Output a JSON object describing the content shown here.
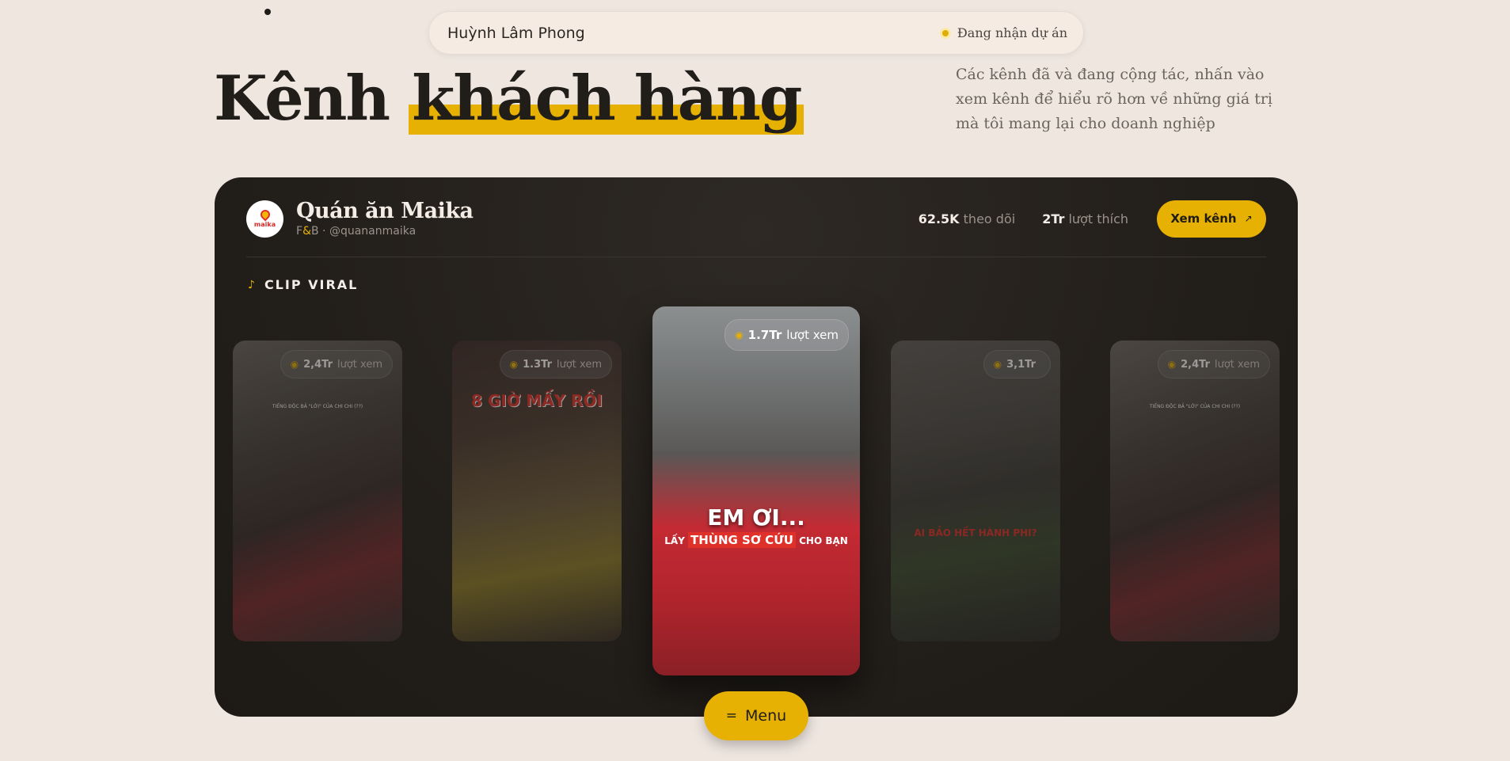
{
  "top_bar": {
    "name": "Huỳnh Lâm Phong",
    "status": "Đang nhận dự án"
  },
  "hero": {
    "title_plain": "Kênh",
    "title_highlight": "khách hàng",
    "description": "Các kênh đã và đang cộng tác, nhấn vào xem kênh để hiểu rõ hơn về những giá trị mà tôi mang lại cho doanh nghiệp"
  },
  "channel": {
    "logo_text": "maika",
    "name": "Quán ăn Maika",
    "category_pre": "F",
    "category_amp": "&",
    "category_post": "B",
    "handle": "· @quananmaika",
    "followers_value": "62.5K",
    "followers_label": "theo dõi",
    "likes_value": "2Tr",
    "likes_label": "lượt thích",
    "view_button": "Xem kênh",
    "view_button_icon": "arrow-up-right-icon"
  },
  "clips_section": {
    "label": "CLIP VIRAL",
    "icon": "music-note-icon"
  },
  "clips": [
    {
      "views": "2,4Tr",
      "views_label": "lượt xem",
      "caption": "TIẾNG ĐỘC BẢ \"LỚI\" CỦA CHI CHI (??)"
    },
    {
      "views": "1.3Tr",
      "views_label": "lượt xem",
      "caption": "8 GIỜ MẤY RỒI"
    },
    {
      "views": "1.7Tr",
      "views_label": "lượt xem",
      "caption_main": "EM ƠI...",
      "caption_sub_pre": "LẤY",
      "caption_sub_red": "THÙNG SƠ CỨU",
      "caption_sub_post": "CHO BẠN"
    },
    {
      "views": "3,1Tr",
      "views_label": "",
      "caption": "AI BẢO HẾT HÀNH PHI?"
    },
    {
      "views": "2,4Tr",
      "views_label": "lượt xem",
      "caption": "TIẾNG ĐỘC BẢ \"LỚI\" CỦA CHI CHI (??)"
    }
  ],
  "menu": {
    "label": "Menu",
    "icon": "hamburger-icon"
  },
  "colors": {
    "background": "#efe6e0",
    "accent": "#e7b104",
    "card": "#221e1a",
    "brand_red": "#e0302a"
  }
}
